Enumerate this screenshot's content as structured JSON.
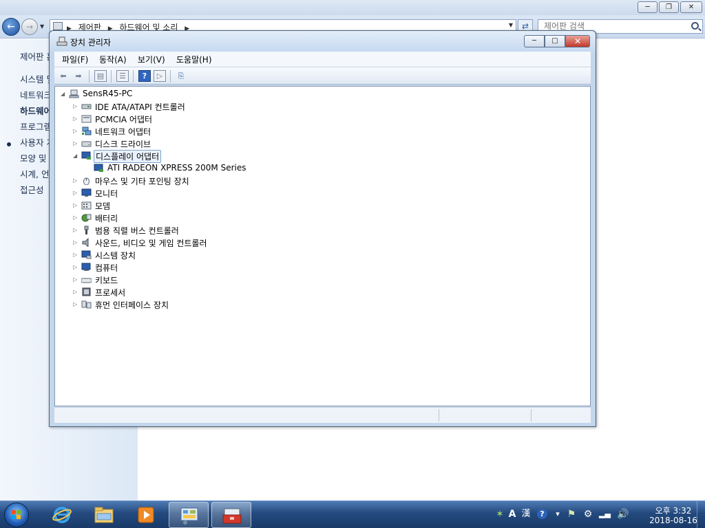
{
  "control_panel": {
    "address": {
      "crumbs": [
        "제어판",
        "하드웨어 및 소리"
      ]
    },
    "search_placeholder": "제어판 검색",
    "nav": {
      "home": "제어판 홈",
      "items": [
        "시스템 및 보안",
        "네트워크 및 인터넷",
        "하드웨어 및 소리",
        "프로그램",
        "사용자 계정 및 가족 보호",
        "모양 및 개인 설정",
        "시계, 언어 및 국가별 옵션",
        "접근성"
      ]
    }
  },
  "device_manager": {
    "title": "장치 관리자",
    "menu": [
      "파일(F)",
      "동작(A)",
      "보기(V)",
      "도움말(H)"
    ],
    "tree": {
      "root": "SensR45-PC",
      "categories": [
        {
          "label": "IDE ATA/ATAPI 컨트롤러",
          "icon": "ide-controller-icon"
        },
        {
          "label": "PCMCIA 어댑터",
          "icon": "pcmcia-icon"
        },
        {
          "label": "네트워크 어댑터",
          "icon": "network-adapter-icon"
        },
        {
          "label": "디스크 드라이브",
          "icon": "disk-drive-icon"
        },
        {
          "label": "디스플레이 어댑터",
          "icon": "display-adapter-icon",
          "expanded": true,
          "children": [
            "ATI RADEON XPRESS 200M Series"
          ]
        },
        {
          "label": "마우스 및 기타 포인팅 장치",
          "icon": "mouse-icon"
        },
        {
          "label": "모니터",
          "icon": "monitor-icon"
        },
        {
          "label": "모뎀",
          "icon": "modem-icon"
        },
        {
          "label": "배터리",
          "icon": "battery-icon"
        },
        {
          "label": "범용 직렬 버스 컨트롤러",
          "icon": "usb-icon"
        },
        {
          "label": "사운드, 비디오 및 게임 컨트롤러",
          "icon": "sound-icon"
        },
        {
          "label": "시스템 장치",
          "icon": "system-device-icon"
        },
        {
          "label": "컴퓨터",
          "icon": "computer-icon"
        },
        {
          "label": "키보드",
          "icon": "keyboard-icon"
        },
        {
          "label": "프로세서",
          "icon": "processor-icon"
        },
        {
          "label": "휴먼 인터페이스 장치",
          "icon": "hid-icon"
        }
      ]
    }
  },
  "taskbar": {
    "clock_time": "오후 3:32",
    "clock_date": "2018-08-16",
    "ime_mode": "A",
    "ime_hanja": "漢"
  },
  "colors": {
    "taskbar": "#23497e",
    "selection": "#e9f2fd",
    "close_button": "#c0392b"
  }
}
